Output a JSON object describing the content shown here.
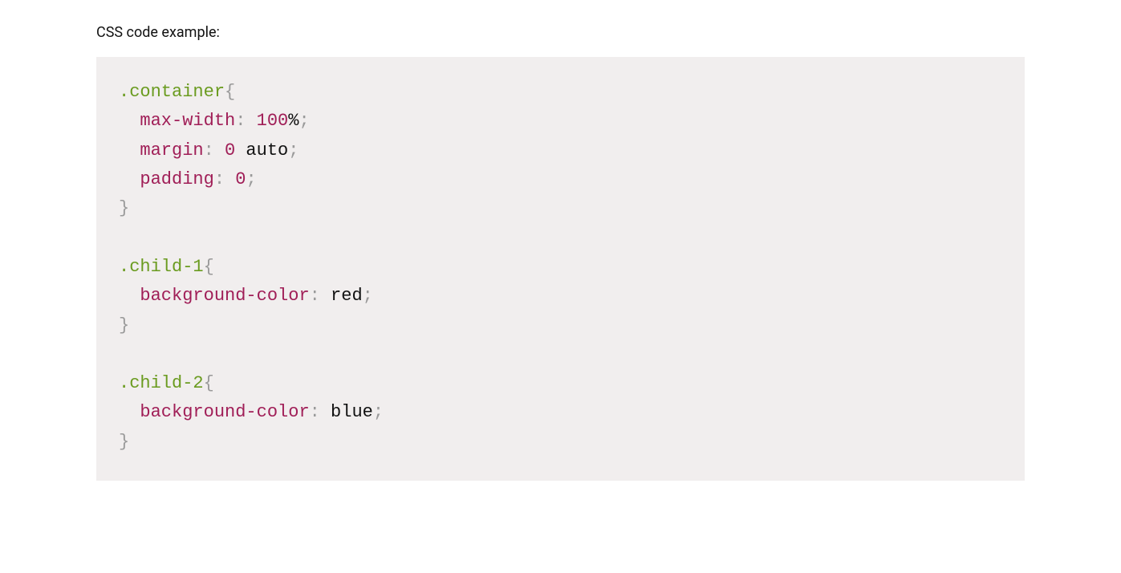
{
  "intro": "CSS code example:",
  "code": {
    "rules": [
      {
        "selector": ".container",
        "declarations": [
          {
            "prop": "max-width",
            "num": "100",
            "unit": "%"
          },
          {
            "prop": "margin",
            "num": "0",
            "val": " auto"
          },
          {
            "prop": "padding",
            "num": "0"
          }
        ]
      },
      {
        "selector": ".child-1",
        "declarations": [
          {
            "prop": "background-color",
            "val": "red"
          }
        ]
      },
      {
        "selector": ".child-2",
        "declarations": [
          {
            "prop": "background-color",
            "val": "blue"
          }
        ]
      }
    ]
  }
}
